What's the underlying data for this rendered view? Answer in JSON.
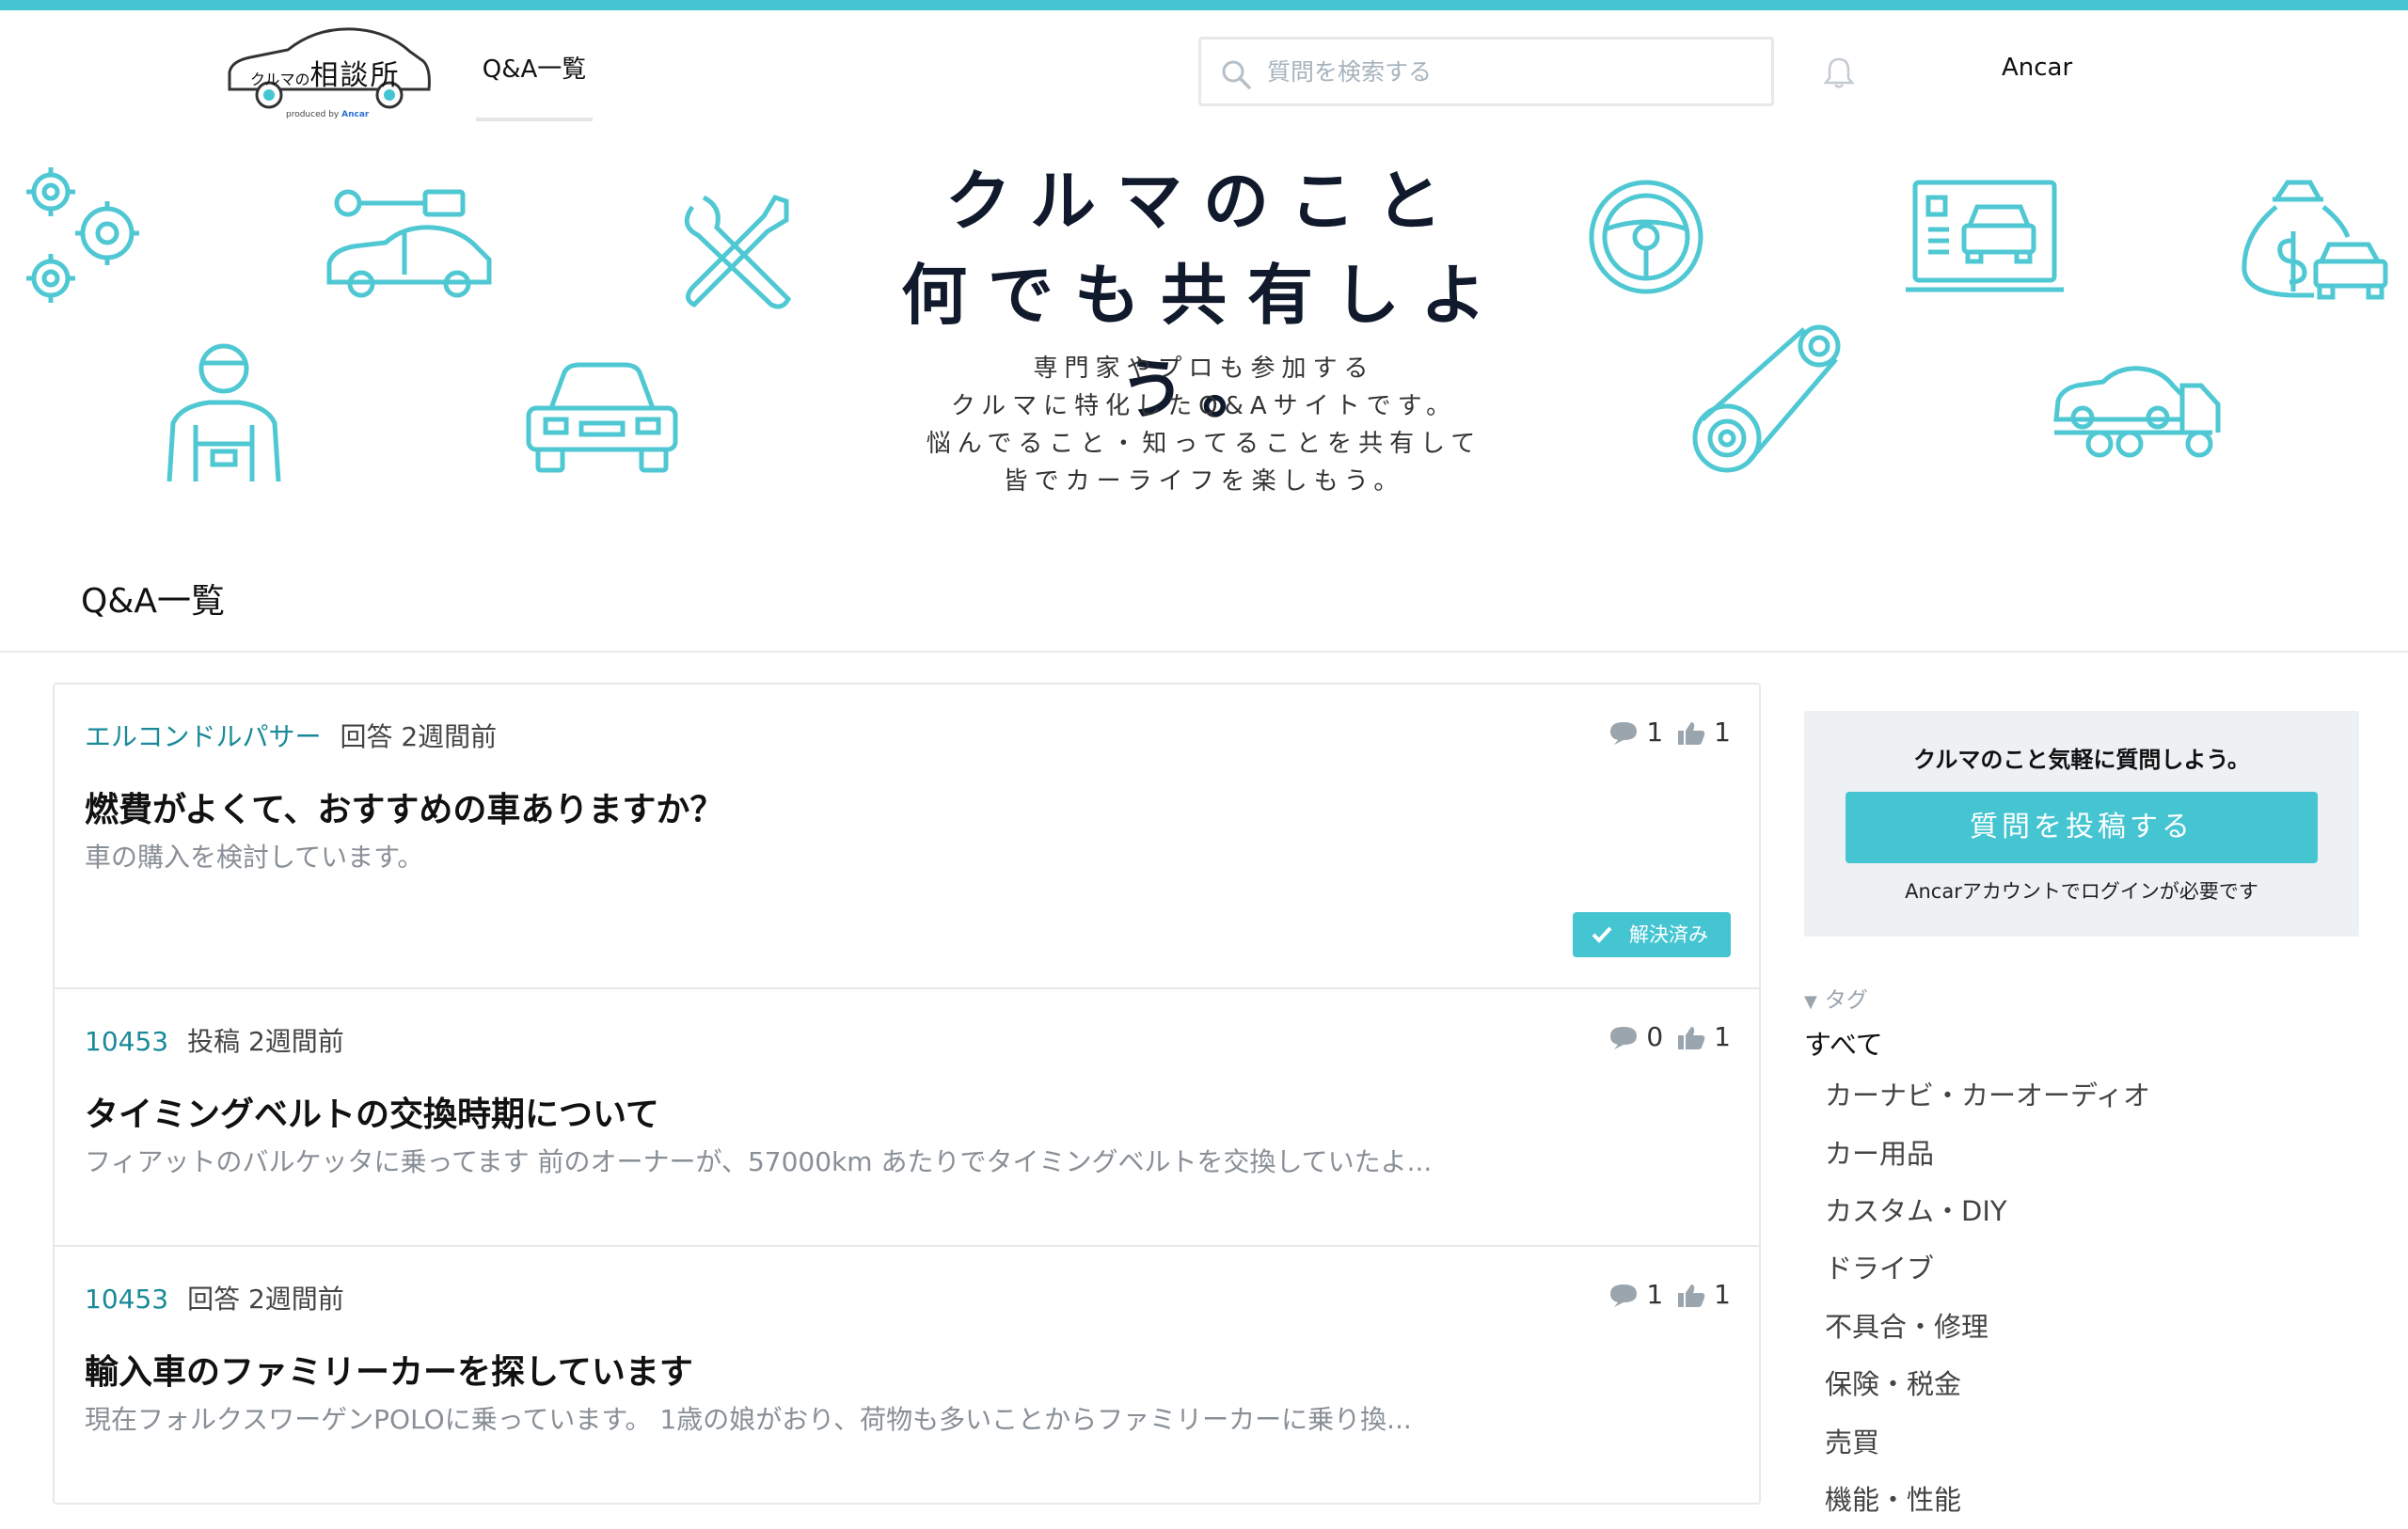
{
  "header": {
    "logo": {
      "text_small": "クルマの",
      "text_large": "相談所",
      "produced_by": "produced by",
      "brand": "Ancar"
    },
    "nav_qa_label": "Q&A一覧",
    "search_placeholder": "質問を検索する",
    "user_name": "Ancar"
  },
  "hero": {
    "title_line1": "クルマのこと",
    "title_line2": "何でも共有しよう。",
    "sub_line1": "専門家やプロも参加する",
    "sub_line2": "クルマに特化したQ&Aサイトです。",
    "sub_line3": "悩んでること・知ってることを共有して",
    "sub_line4": "皆でカーライフを楽しもう。"
  },
  "main": {
    "section_title": "Q&A一覧",
    "questions": [
      {
        "author": "エルコンドルパサー",
        "info": "回答 2週間前",
        "comments": "1",
        "likes": "1",
        "title": "燃費がよくて、おすすめの車ありますか？",
        "excerpt": "車の購入を検討しています。",
        "badge": "解決済み"
      },
      {
        "author": "10453",
        "info": "投稿 2週間前",
        "comments": "0",
        "likes": "1",
        "title": "タイミングベルトの交換時期について",
        "excerpt": "フィアットのバルケッタに乗ってます 前のオーナーが、57000km あたりでタイミングベルトを交換していたよ..."
      },
      {
        "author": "10453",
        "info": "回答 2週間前",
        "comments": "1",
        "likes": "1",
        "title": "輸入車のファミリーカーを探しています",
        "excerpt": "現在フォルクスワーゲンPOLOに乗っています。 1歳の娘がおり、荷物も多いことからファミリーカーに乗り換..."
      }
    ]
  },
  "sidebar": {
    "cta_title": "クルマのこと気軽に質問しよう。",
    "cta_button": "質問を投稿する",
    "cta_note": "Ancarアカウントでログインが必要です",
    "tags_heading_icon": "▼",
    "tags_heading": "タグ",
    "tag_all": "すべて",
    "tags": [
      "カーナビ・カーオーディオ",
      "カー用品",
      "カスタム・DIY",
      "ドライブ",
      "不具合・修理",
      "保険・税金",
      "売買",
      "機能・性能"
    ]
  },
  "colors": {
    "accent": "#45c5d2",
    "author": "#1a8a99",
    "muted": "#888f96"
  }
}
